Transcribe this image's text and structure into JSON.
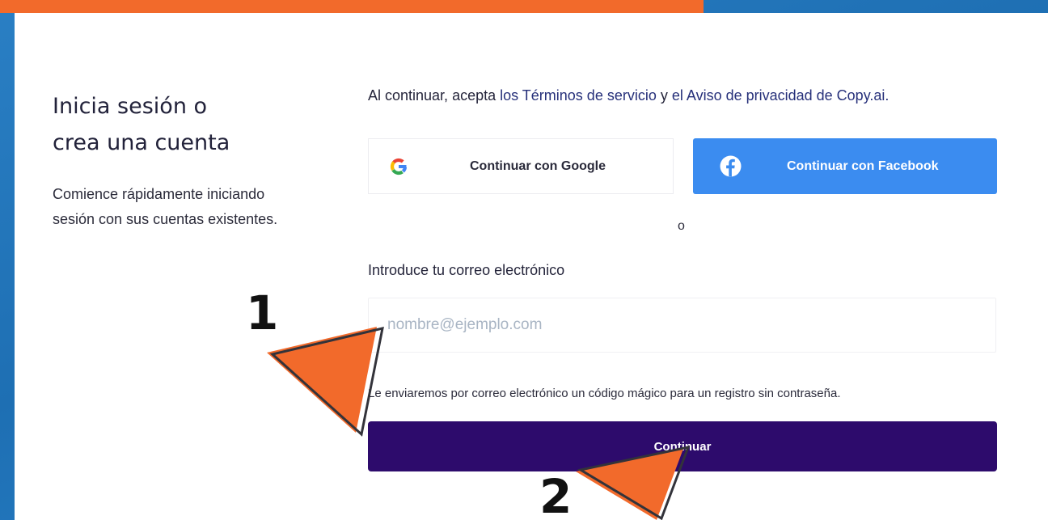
{
  "login": {
    "heading_line1": "Inicia sesión o",
    "heading_line2": "crea una cuenta",
    "subtext_line1": "Comience rápidamente iniciando",
    "subtext_line2": "sesión con sus cuentas existentes.",
    "terms_prefix": "Al continuar, acepta ",
    "terms_link1": "los Términos de servicio",
    "terms_connector": " y ",
    "terms_link2": "el Aviso de privacidad de Copy.ai.",
    "google_button": "Continuar con Google",
    "facebook_button": "Continuar con Facebook",
    "or_separator": "o",
    "email_label": "Introduce tu correo electrónico",
    "email_placeholder": "nombre@ejemplo.com",
    "email_value": "",
    "hint": "Le enviaremos por correo electrónico un código mágico para un registro sin contraseña.",
    "continue_button": "Continuar"
  },
  "annotations": {
    "step1": "1",
    "step2": "2"
  },
  "icons": {
    "google": "google-logo-icon",
    "facebook": "facebook-logo-icon",
    "cursor": "pointer-arrow-icon"
  },
  "colors": {
    "background": "#2a7fc4",
    "accent": "#f26a2b",
    "primary_button": "#2d0b6c",
    "facebook_button": "#3b8cf0",
    "link": "#26307a"
  }
}
